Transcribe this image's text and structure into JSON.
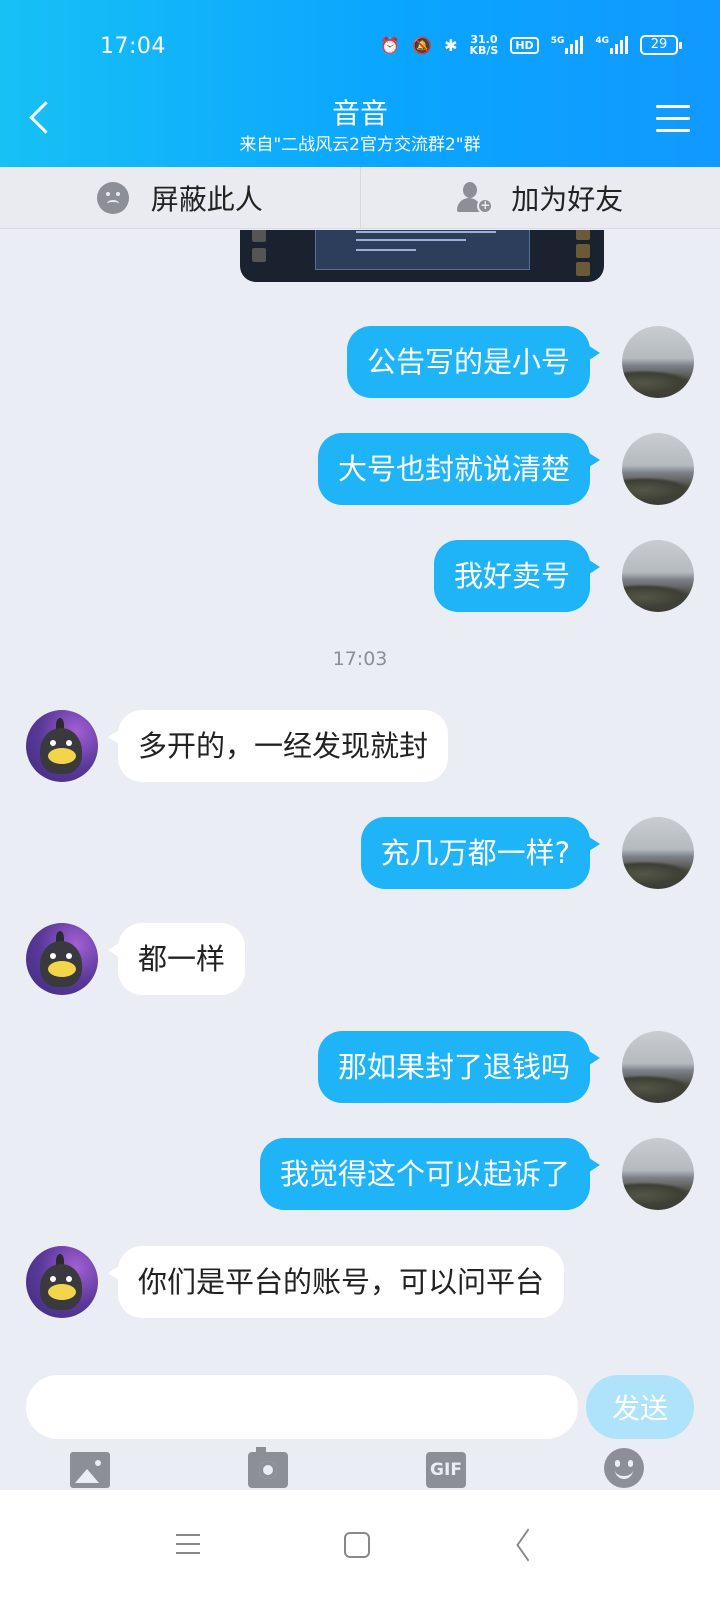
{
  "status_bar": {
    "time": "17:04",
    "net_speed_value": "31.0",
    "net_speed_unit": "KB/S",
    "hd_label": "HD",
    "sig1_label": "5G",
    "sig2_label": "4G",
    "battery": "29"
  },
  "header": {
    "title": "音音",
    "subtitle": "来自\"二战风云2官方交流群2\"群"
  },
  "actions": {
    "block_label": "屏蔽此人",
    "add_friend_label": "加为好友"
  },
  "messages": [
    {
      "side": "me",
      "text": "公告写的是小号"
    },
    {
      "side": "me",
      "text": "大号也封就说清楚"
    },
    {
      "side": "me",
      "text": "我好卖号"
    },
    {
      "side": "them",
      "text": "多开的，一经发现就封"
    },
    {
      "side": "me",
      "text": "充几万都一样?"
    },
    {
      "side": "them",
      "text": "都一样"
    },
    {
      "side": "me",
      "text": "那如果封了退钱吗"
    },
    {
      "side": "me",
      "text": "我觉得这个可以起诉了"
    },
    {
      "side": "them",
      "text": "你们是平台的账号，可以问平台"
    }
  ],
  "timestamp": "17:03",
  "input": {
    "placeholder": "",
    "send_label": "发送",
    "gif_label": "GIF"
  },
  "colors": {
    "accent": "#1eb4f7",
    "header_start": "#17c0f5",
    "header_end": "#1199ff",
    "send_disabled": "#aee3fb"
  }
}
